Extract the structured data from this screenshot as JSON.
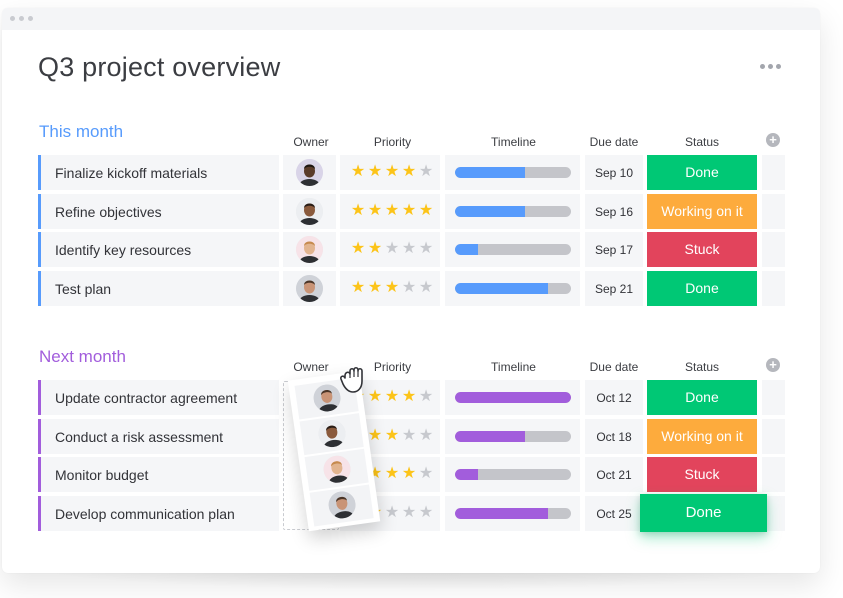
{
  "window": {
    "title": "Q3 project overview",
    "menu_icon": "more-horizontal-icon"
  },
  "columns": {
    "owner": "Owner",
    "priority": "Priority",
    "timeline": "Timeline",
    "due_date": "Due date",
    "status": "Status",
    "add_icon": "plus-circle-icon"
  },
  "status_colors": {
    "Done": "#00c875",
    "Working on it": "#fdab3d",
    "Stuck": "#e2445c"
  },
  "groups": [
    {
      "title": "This month",
      "color": "#579bfc",
      "rows": [
        {
          "name": "Finalize kickoff materials",
          "owner": "owner-avatar-1",
          "priority": 4,
          "timeline_progress": 0.6,
          "due_date": "Sep 10",
          "status": "Done"
        },
        {
          "name": "Refine objectives",
          "owner": "owner-avatar-2",
          "priority": 5,
          "timeline_progress": 0.6,
          "due_date": "Sep 16",
          "status": "Working on it"
        },
        {
          "name": "Identify key resources",
          "owner": "owner-avatar-3",
          "priority": 2,
          "timeline_progress": 0.2,
          "due_date": "Sep 17",
          "status": "Stuck"
        },
        {
          "name": "Test plan",
          "owner": "owner-avatar-4",
          "priority": 3,
          "timeline_progress": 0.8,
          "due_date": "Sep 21",
          "status": "Done"
        }
      ]
    },
    {
      "title": "Next month",
      "color": "#a25ddc",
      "rows": [
        {
          "name": "Update contractor agreement",
          "owner": "owner-avatar-4",
          "priority": 4,
          "timeline_progress": 1.0,
          "due_date": "Oct 12",
          "status": "Done"
        },
        {
          "name": "Conduct a risk assessment",
          "owner": "owner-avatar-2",
          "priority": 3,
          "timeline_progress": 0.6,
          "due_date": "Oct 18",
          "status": "Working on it"
        },
        {
          "name": "Monitor budget",
          "owner": "owner-avatar-3",
          "priority": 4,
          "timeline_progress": 0.2,
          "due_date": "Oct 21",
          "status": "Stuck"
        },
        {
          "name": "Develop communication plan",
          "owner": "owner-avatar-4",
          "priority": 2,
          "timeline_progress": 0.8,
          "due_date": "Oct 25",
          "status": "Done"
        }
      ]
    }
  ],
  "drag_overlay": {
    "cursor_icon": "grab-hand-icon",
    "dragged_status_label": "Done"
  }
}
